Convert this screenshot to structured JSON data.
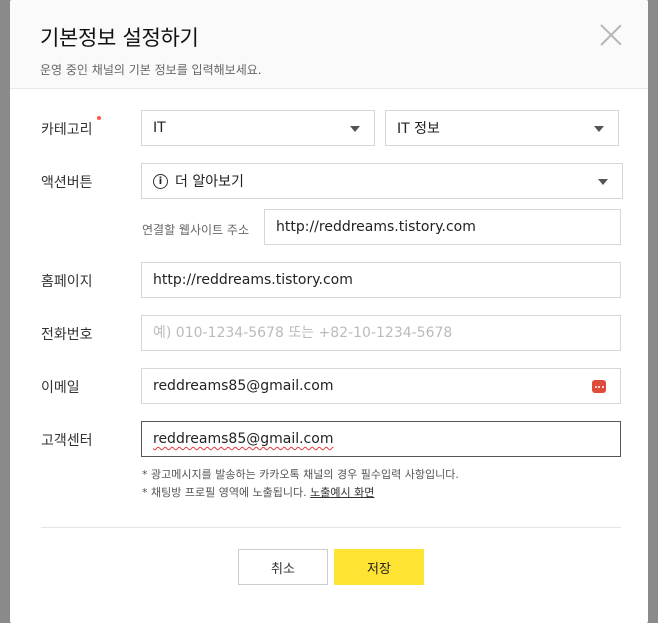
{
  "modal": {
    "title": "기본정보 설정하기",
    "subtitle": "운영 중인 채널의 기본 정보를 입력해보세요."
  },
  "category": {
    "label": "카테고리",
    "primary_value": "IT",
    "secondary_value": "IT 정보"
  },
  "action_button": {
    "label": "액션버튼",
    "value": "더 알아보기",
    "url_label": "연결할 웹사이트 주소",
    "url_value": "http://reddreams.tistory.com"
  },
  "homepage": {
    "label": "홈페이지",
    "value": "http://reddreams.tistory.com"
  },
  "phone": {
    "label": "전화번호",
    "value": "",
    "placeholder": "예) 010-1234-5678 또는 +82-10-1234-5678"
  },
  "email": {
    "label": "이메일",
    "value": "reddreams85@gmail.com"
  },
  "support": {
    "label": "고객센터",
    "value": "reddreams85@gmail.com"
  },
  "notes": {
    "line1": "* 광고메시지를 발송하는 카카오톡 채널의 경우 필수입력 사항입니다.",
    "line2_prefix": "* 채팅방 프로필 영역에 노출됩니다.",
    "line2_link": "노출예시 화면"
  },
  "buttons": {
    "cancel": "취소",
    "save": "저장"
  },
  "colors": {
    "accent": "#fee333",
    "required_dot": "#ff5a4a"
  },
  "icons": {
    "close": "close-icon",
    "caret": "chevron-down-icon",
    "info": "info-icon",
    "extension": "password-manager-icon"
  }
}
